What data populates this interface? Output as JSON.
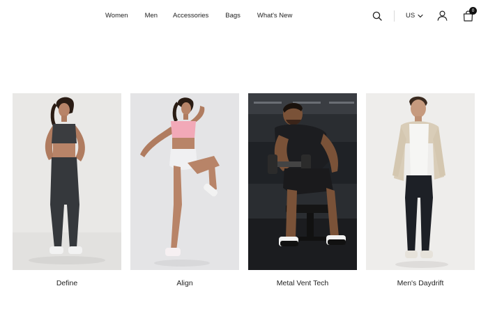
{
  "nav": {
    "items": [
      {
        "label": "Women"
      },
      {
        "label": "Men"
      },
      {
        "label": "Accessories"
      },
      {
        "label": "Bags"
      },
      {
        "label": "What's New"
      }
    ]
  },
  "header": {
    "locale": "US",
    "cart_count": "0",
    "icons": [
      "search-icon",
      "chevron-down-icon",
      "user-icon",
      "shopping-bag-icon"
    ]
  },
  "products": [
    {
      "name": "Define"
    },
    {
      "name": "Align"
    },
    {
      "name": "Metal Vent Tech"
    },
    {
      "name": "Men's Daydrift"
    }
  ],
  "colors": {
    "background": "#ffffff",
    "text": "#222222",
    "badge": "#111111"
  }
}
